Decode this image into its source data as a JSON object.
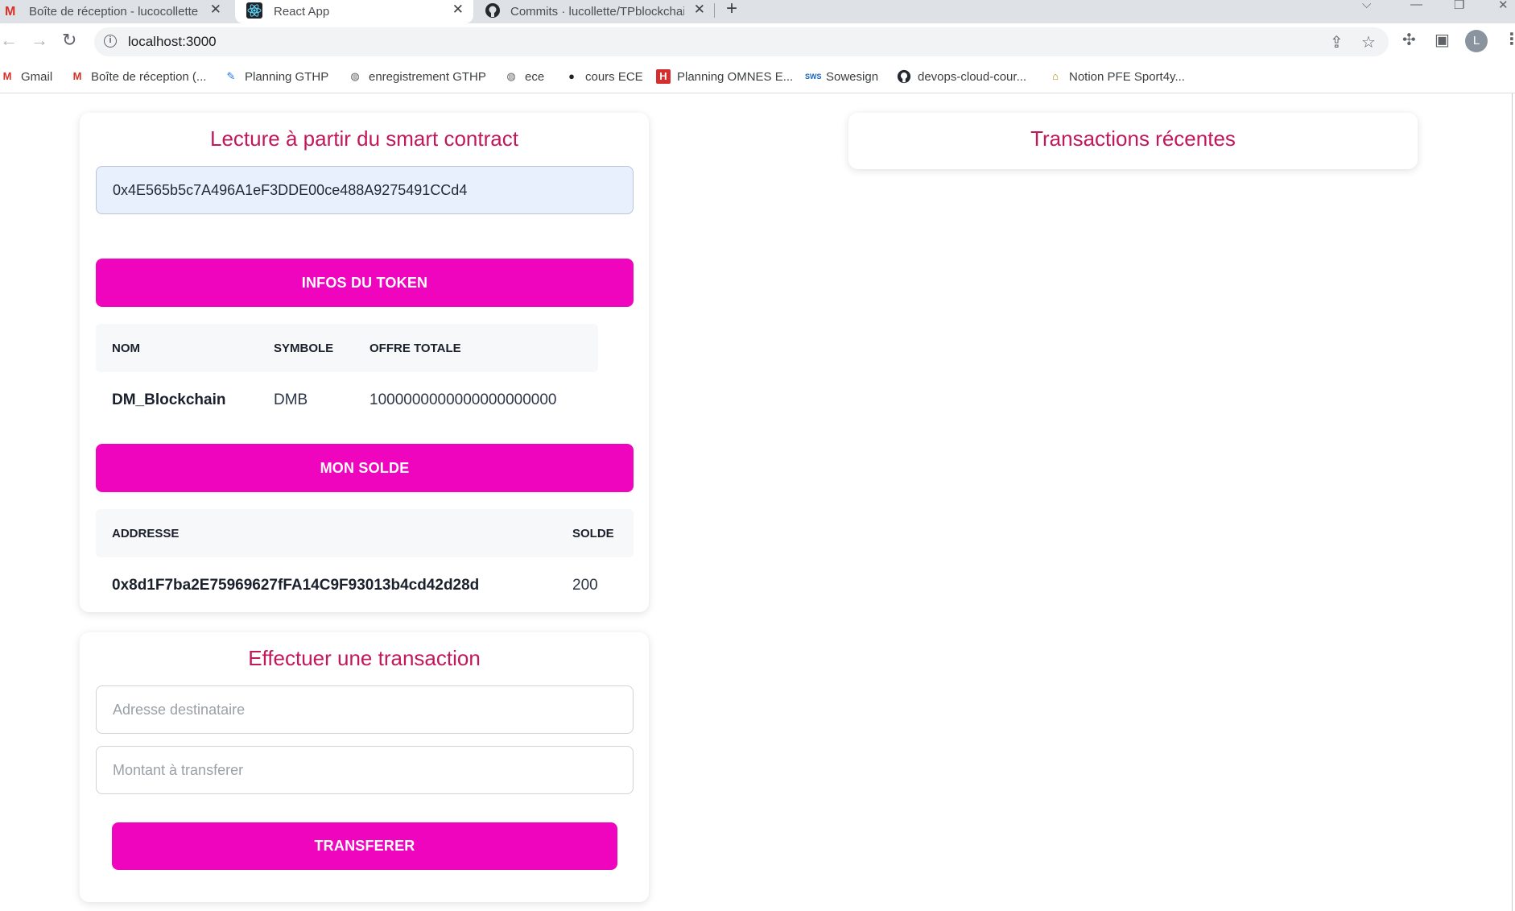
{
  "browser": {
    "tabs": [
      {
        "title": "Boîte de réception - lucocollette",
        "icon": "gmail-icon",
        "active": false
      },
      {
        "title": "React App",
        "icon": "react-icon",
        "active": true
      },
      {
        "title": "Commits · lucollette/TPblockchai",
        "icon": "github-icon",
        "active": false
      }
    ],
    "url": "localhost:3000",
    "profile_initial": "L",
    "bookmarks": [
      {
        "label": "Gmail",
        "icon": "gmail-icon"
      },
      {
        "label": "Boîte de réception (...",
        "icon": "gmail-icon"
      },
      {
        "label": "Planning GTHP",
        "icon": "planning-icon"
      },
      {
        "label": "enregistrement GTHP",
        "icon": "globe-icon"
      },
      {
        "label": "ece",
        "icon": "globe-icon"
      },
      {
        "label": "cours ECE",
        "icon": "ece-icon"
      },
      {
        "label": "Planning OMNES E...",
        "icon": "h-icon"
      },
      {
        "label": "Sowesign",
        "icon": "sowesign-icon"
      },
      {
        "label": "devops-cloud-cour...",
        "icon": "github-icon"
      },
      {
        "label": "Notion PFE Sport4y...",
        "icon": "notion-icon"
      }
    ]
  },
  "read_card": {
    "title": "Lecture à partir du smart contract",
    "contract_address": "0x4E565b5c7A496A1eF3DDE00ce488A9275491CCd4",
    "token_info_button": "INFOS DU TOKEN",
    "token_table": {
      "headers": [
        "NOM",
        "SYMBOLE",
        "OFFRE TOTALE"
      ],
      "row": [
        "DM_Blockchain",
        "DMB",
        "1000000000000000000000"
      ]
    },
    "balance_button": "MON SOLDE",
    "balance_table": {
      "headers": [
        "ADDRESSE",
        "SOLDE"
      ],
      "row": [
        "0x8d1F7ba2E75969627fFA14C9F93013b4cd42d28d",
        "200"
      ]
    }
  },
  "transactions_card": {
    "title": "Transactions récentes"
  },
  "transfer_card": {
    "title": "Effectuer une transaction",
    "recipient_placeholder": "Adresse destinataire",
    "amount_placeholder": "Montant à transferer",
    "submit_button": "TRANSFERER"
  },
  "colors": {
    "accent": "#f005be",
    "title": "#c2185b",
    "input_highlight": "#e8f0fe"
  }
}
